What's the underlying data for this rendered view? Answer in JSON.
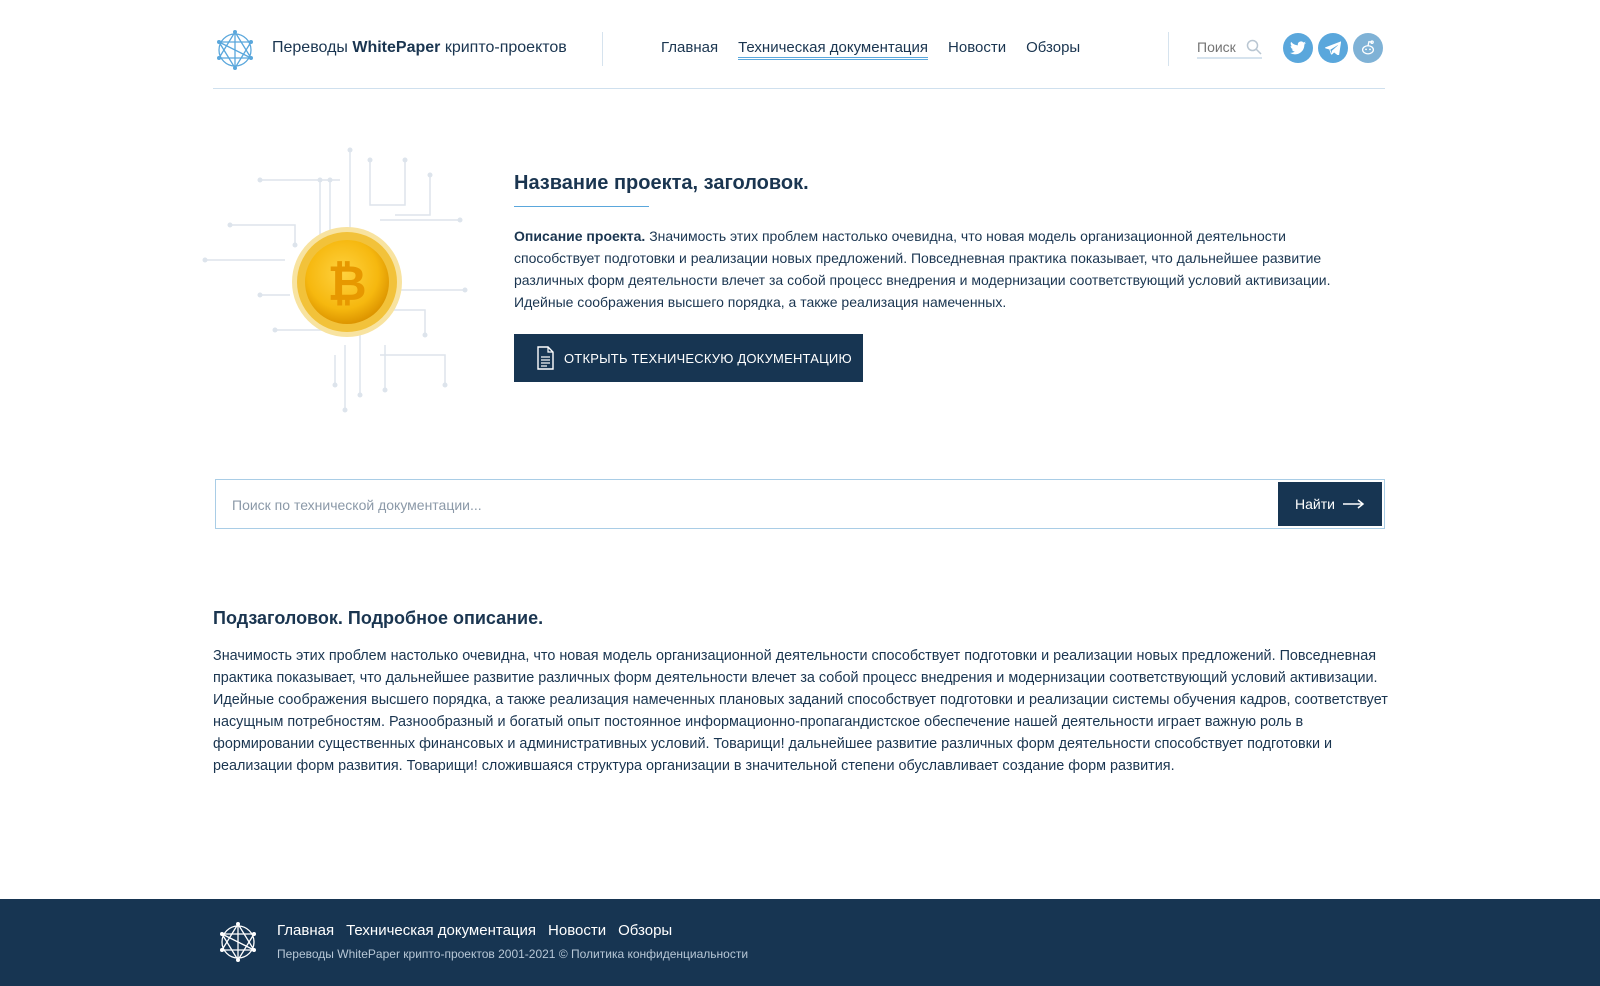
{
  "header": {
    "brand_prefix": "Переводы",
    "brand_bold": "WhitePaper",
    "brand_suffix": "крипто-проектов",
    "nav": [
      "Главная",
      "Техническая документация",
      "Новости",
      "Обзоры"
    ],
    "active_nav": "Техническая документация",
    "search_placeholder": "Поиск",
    "socials": [
      "twitter-icon",
      "telegram-icon",
      "reddit-icon"
    ]
  },
  "hero": {
    "title": "Название проекта, заголовок.",
    "desc_label": "Описание проекта.",
    "desc_text": "Значимость этих проблем настолько очевидна, что новая модель организационной деятельности способствует подготовки и реализации новых предложений. Повседневная практика показывает, что дальнейшее развитие различных форм деятельности влечет за собой процесс внедрения и модернизации соответствующий условий активизации. Идейные соображения высшего порядка, а также реализация намеченных.",
    "button_label": "ОТКРЫТЬ ТЕХНИЧЕСКУЮ ДОКУМЕНТАЦИЮ",
    "coin_icon": "bitcoin-icon"
  },
  "doc_search": {
    "placeholder": "Поиск по технической документации...",
    "button_label": "Найти"
  },
  "details": {
    "title": "Подзаголовок. Подробное описание.",
    "text": "Значимость этих проблем настолько очевидна, что новая модель организационной деятельности способствует подготовки и реализации новых предложений. Повседневная практика показывает, что дальнейшее развитие различных форм деятельности влечет за собой процесс внедрения и модернизации соответствующий условий активизации. Идейные соображения высшего порядка, а также реализация намеченных плановых заданий способствует подготовки и реализации системы обучения кадров, соответствует насущным потребностям. Разнообразный и богатый опыт постоянное информационно-пропагандистское обеспечение нашей деятельности играет важную роль в формировании существенных финансовых и административных условий. Товарищи! дальнейшее развитие различных форм деятельности способствует подготовки и реализации форм развития. Товарищи! сложившаяся структура организации в значительной степени обуславливает создание форм развития."
  },
  "footer": {
    "nav": [
      "Главная",
      "Техническая документация",
      "Новости",
      "Обзоры"
    ],
    "copyright": "Переводы WhitePaper крипто-проектов 2001-2021 ©",
    "privacy": "Политика конфиденциальности"
  },
  "colors": {
    "dark_navy": "#173552",
    "accent_blue": "#5aa7dc",
    "coin_gold": "#f6b80f"
  }
}
